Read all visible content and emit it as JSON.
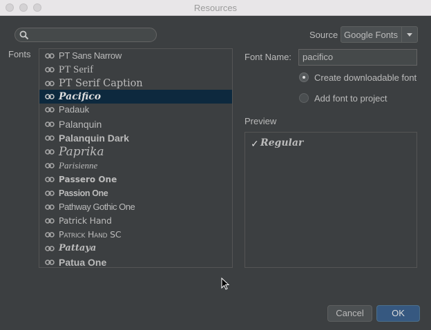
{
  "window": {
    "title": "Resources"
  },
  "search": {
    "value": ""
  },
  "source": {
    "label": "Source",
    "selected": "Google Fonts"
  },
  "fonts_label": "Fonts",
  "font_list": [
    {
      "name": "PT Sans Narrow",
      "selected": false
    },
    {
      "name": "PT Serif",
      "selected": false
    },
    {
      "name": "PT Serif Caption",
      "selected": false
    },
    {
      "name": "Pacifico",
      "selected": true
    },
    {
      "name": "Padauk",
      "selected": false
    },
    {
      "name": "Palanquin",
      "selected": false
    },
    {
      "name": "Palanquin Dark",
      "selected": false
    },
    {
      "name": "Paprika",
      "selected": false
    },
    {
      "name": "Parisienne",
      "selected": false
    },
    {
      "name": "Passero One",
      "selected": false
    },
    {
      "name": "Passion One",
      "selected": false
    },
    {
      "name": "Pathway Gothic One",
      "selected": false
    },
    {
      "name": "Patrick Hand",
      "selected": false
    },
    {
      "name": "Patrick Hand SC",
      "selected": false
    },
    {
      "name": "Pattaya",
      "selected": false
    },
    {
      "name": "Patua One",
      "selected": false
    }
  ],
  "font_name": {
    "label": "Font Name:",
    "value": "pacifico"
  },
  "options": [
    {
      "label": "Create downloadable font",
      "checked": true
    },
    {
      "label": "Add font to project",
      "checked": false
    }
  ],
  "preview": {
    "label": "Preview",
    "items": [
      {
        "check": "✓",
        "label": "Regular"
      }
    ]
  },
  "buttons": {
    "cancel": "Cancel",
    "ok": "OK"
  },
  "icons": {
    "search": "search-icon",
    "link": "link-icon",
    "dropdown": "chevron-down-icon"
  }
}
